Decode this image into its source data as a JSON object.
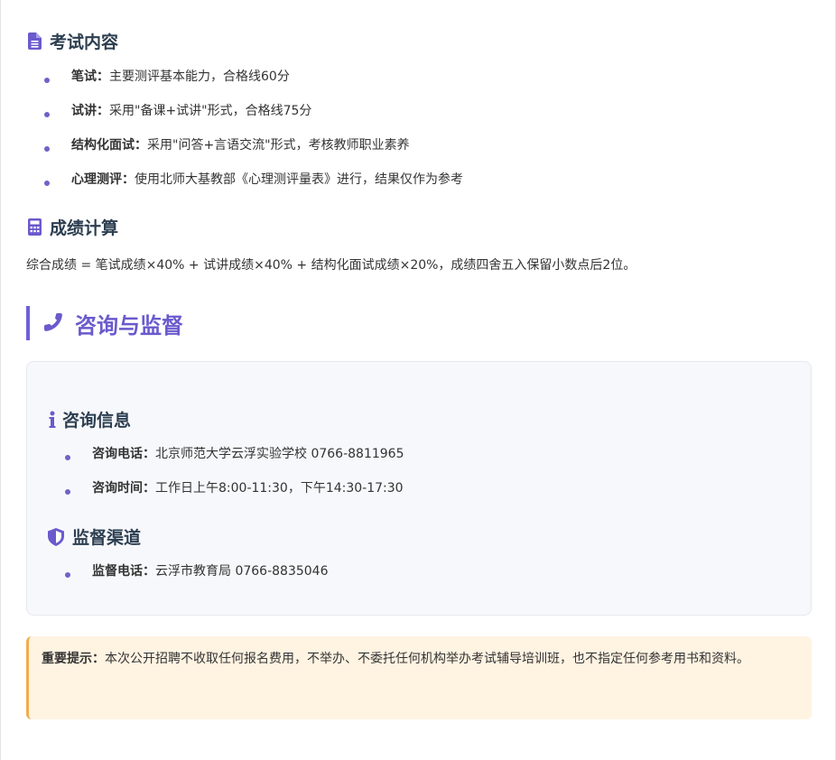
{
  "exam_content": {
    "title": "考试内容",
    "items": [
      {
        "label": "笔试：",
        "text": "主要测评基本能力，合格线60分"
      },
      {
        "label": "试讲：",
        "text": "采用\"备课+试讲\"形式，合格线75分"
      },
      {
        "label": "结构化面试：",
        "text": "采用\"问答+言语交流\"形式，考核教师职业素养"
      },
      {
        "label": "心理测评：",
        "text": "使用北师大基教部《心理测评量表》进行，结果仅作为参考"
      }
    ]
  },
  "score_calc": {
    "title": "成绩计算",
    "formula": "综合成绩 = 笔试成绩×40% + 试讲成绩×40% + 结构化面试成绩×20%，成绩四舍五入保留小数点后2位。"
  },
  "consult_section": {
    "title": "咨询与监督",
    "info": {
      "title": "咨询信息",
      "items": [
        {
          "label": "咨询电话：",
          "text": "北京师范大学云浮实验学校 0766-8811965"
        },
        {
          "label": "咨询时间：",
          "text": "工作日上午8:00-11:30，下午14:30-17:30"
        }
      ]
    },
    "supervision": {
      "title": "监督渠道",
      "items": [
        {
          "label": "监督电话：",
          "text": "云浮市教育局 0766-8835046"
        }
      ]
    }
  },
  "notice": {
    "label": "重要提示：",
    "text": "本次公开招聘不收取任何报名费用，不举办、不委托任何机构举办考试辅导培训班，也不指定任何参考用书和资料。"
  },
  "colors": {
    "accent": "#6a5acd",
    "heading": "#2c3e50",
    "card_bg": "#f7f8fb",
    "notice_bg": "#fff3e2",
    "notice_border": "#f0ad4e"
  },
  "icons": {
    "exam_content": "file-text-icon",
    "score_calc": "calculator-icon",
    "consult_section": "phone-icon",
    "info": "info-icon",
    "supervision": "shield-icon"
  }
}
